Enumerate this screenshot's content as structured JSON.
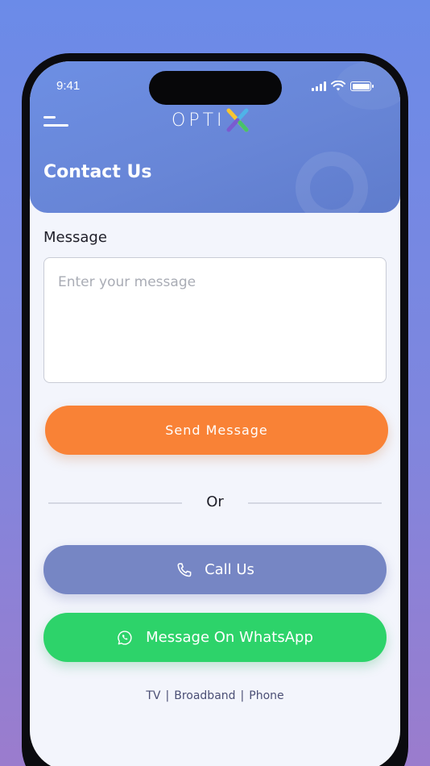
{
  "status_bar": {
    "time": "9:41"
  },
  "header": {
    "logo_text": "OPTI",
    "logo_mark": "X",
    "title": "Contact Us",
    "menu_icon": "hamburger-menu-icon"
  },
  "form": {
    "message_label": "Message",
    "message_placeholder": "Enter your message",
    "message_value": "",
    "send_label": "Send Message"
  },
  "divider": {
    "text": "Or"
  },
  "actions": {
    "call_label": "Call Us",
    "call_icon": "phone-icon",
    "whatsapp_label": "Message On WhatsApp",
    "whatsapp_icon": "whatsapp-icon"
  },
  "footer": {
    "links": [
      "TV",
      "Broadband",
      "Phone"
    ],
    "separator": "|"
  },
  "colors": {
    "background_top": "#6b8be8",
    "background_bottom": "#9b7ccd",
    "header": "#6886d7",
    "send_button": "#f98236",
    "call_button": "#7686c4",
    "whatsapp_button": "#2dd36a",
    "footer_text": "#4b4f75"
  }
}
